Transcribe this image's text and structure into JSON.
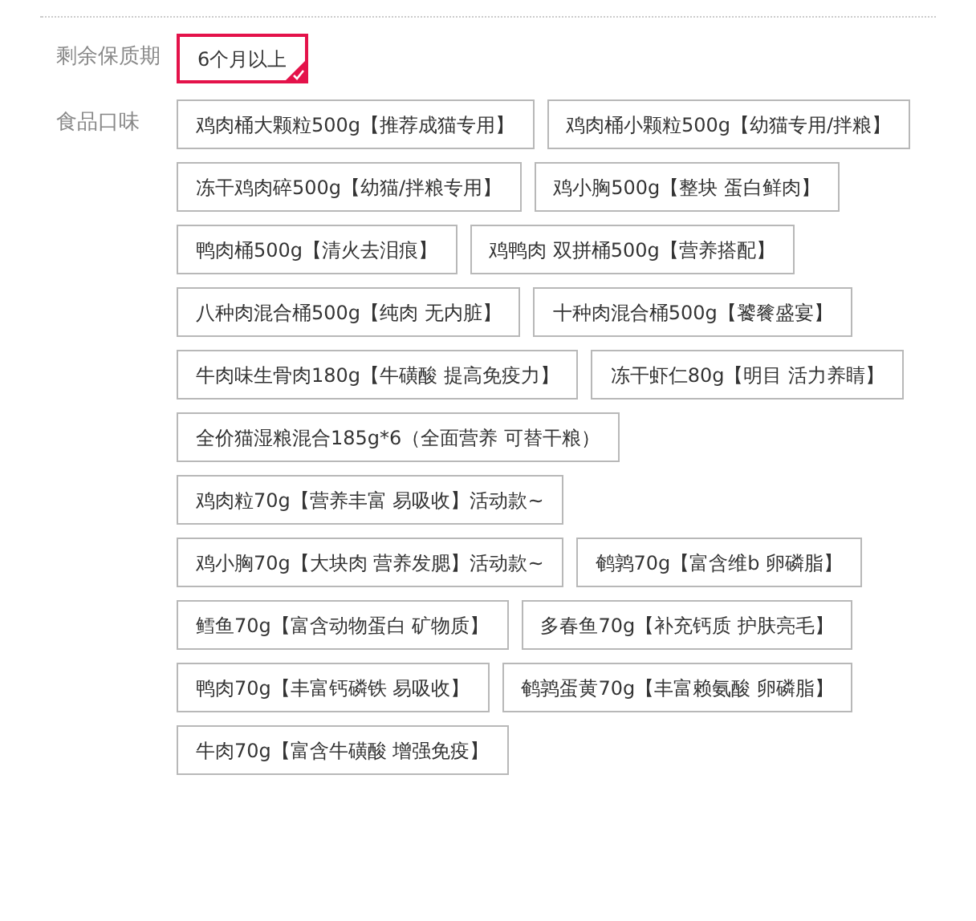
{
  "properties": [
    {
      "label": "剩余保质期",
      "options": [
        {
          "text": "6个月以上",
          "selected": true
        }
      ]
    },
    {
      "label": "食品口味",
      "options": [
        {
          "text": "鸡肉桶大颗粒500g【推荐成猫专用】",
          "selected": false
        },
        {
          "text": "鸡肉桶小颗粒500g【幼猫专用/拌粮】",
          "selected": false
        },
        {
          "text": "冻干鸡肉碎500g【幼猫/拌粮专用】",
          "selected": false
        },
        {
          "text": "鸡小胸500g【整块 蛋白鲜肉】",
          "selected": false
        },
        {
          "text": "鸭肉桶500g【清火去泪痕】",
          "selected": false
        },
        {
          "text": "鸡鸭肉 双拼桶500g【营养搭配】",
          "selected": false
        },
        {
          "text": "八种肉混合桶500g【纯肉 无内脏】",
          "selected": false
        },
        {
          "text": "十种肉混合桶500g【饕餮盛宴】",
          "selected": false
        },
        {
          "text": "牛肉味生骨肉180g【牛磺酸 提高免疫力】",
          "selected": false
        },
        {
          "text": "冻干虾仁80g【明目 活力养睛】",
          "selected": false
        },
        {
          "text": "全价猫湿粮混合185g*6（全面营养 可替干粮）",
          "selected": false
        },
        {
          "text": "鸡肉粒70g【营养丰富 易吸收】活动款~",
          "selected": false
        },
        {
          "text": "鸡小胸70g【大块肉 营养发腮】活动款~",
          "selected": false
        },
        {
          "text": "鹌鹑70g【富含维b 卵磷脂】",
          "selected": false
        },
        {
          "text": "鳕鱼70g【富含动物蛋白 矿物质】",
          "selected": false
        },
        {
          "text": "多春鱼70g【补充钙质 护肤亮毛】",
          "selected": false
        },
        {
          "text": "鸭肉70g【丰富钙磷铁 易吸收】",
          "selected": false
        },
        {
          "text": "鹌鹑蛋黄70g【丰富赖氨酸 卵磷脂】",
          "selected": false
        },
        {
          "text": "牛肉70g【富含牛磺酸 增强免疫】",
          "selected": false
        }
      ]
    }
  ]
}
